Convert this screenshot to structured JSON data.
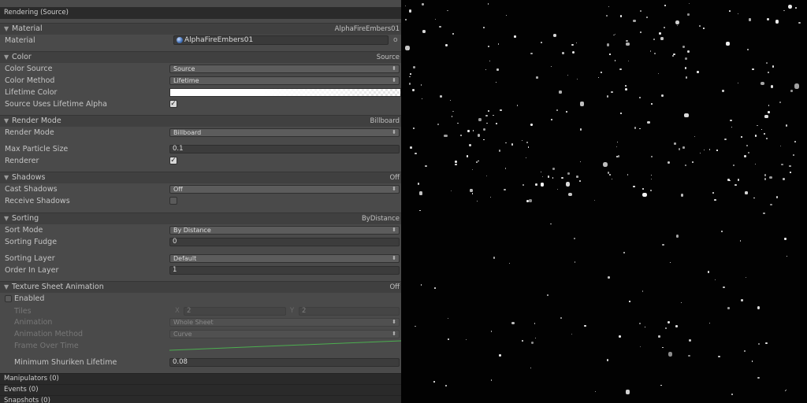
{
  "panel_title": "Rendering (Source)",
  "material": {
    "header": "Material",
    "header_value": "AlphaFireEmbers01",
    "label": "Material",
    "value": "AlphaFireEmbers01",
    "picker_glyph": "o"
  },
  "color": {
    "header": "Color",
    "header_value": "Source",
    "source_label": "Color Source",
    "source_value": "Source",
    "method_label": "Color Method",
    "method_value": "Lifetime",
    "lifetime_label": "Lifetime Color",
    "uses_alpha_label": "Source Uses Lifetime Alpha",
    "uses_alpha_checked": "✓"
  },
  "render_mode": {
    "header": "Render Mode",
    "header_value": "Billboard",
    "mode_label": "Render Mode",
    "mode_value": "Billboard",
    "max_size_label": "Max Particle Size",
    "max_size_value": "0.1",
    "renderer_label": "Renderer",
    "renderer_checked": "✓"
  },
  "shadows": {
    "header": "Shadows",
    "header_value": "Off",
    "cast_label": "Cast Shadows",
    "cast_value": "Off",
    "receive_label": "Receive Shadows"
  },
  "sorting": {
    "header": "Sorting",
    "header_value": "ByDistance",
    "mode_label": "Sort Mode",
    "mode_value": "By Distance",
    "fudge_label": "Sorting Fudge",
    "fudge_value": "0",
    "layer_label": "Sorting Layer",
    "layer_value": "Default",
    "order_label": "Order In Layer",
    "order_value": "1"
  },
  "texture_sheet": {
    "header": "Texture Sheet Animation",
    "header_value": "Off",
    "enabled_label": "Enabled",
    "tiles_label": "Tiles",
    "x_label": "X",
    "x_value": "2",
    "y_label": "Y",
    "y_value": "2",
    "animation_label": "Animation",
    "animation_value": "Whole Sheet",
    "anim_method_label": "Animation Method",
    "anim_method_value": "Curve",
    "frame_label": "Frame Over Time",
    "min_lifetime_label": "Minimum Shuriken Lifetime",
    "min_lifetime_value": "0.08"
  },
  "footer": {
    "manipulators": "Manipulators (0)",
    "events": "Events (0)",
    "snapshots": "Snapshots (0)"
  },
  "icons": {
    "foldout": "▼",
    "dropdown_arrow": "⬍"
  },
  "colors": {
    "panel_bg": "#4a4a4a",
    "viewport_bg": "#020202",
    "curve": "#4caf50"
  }
}
